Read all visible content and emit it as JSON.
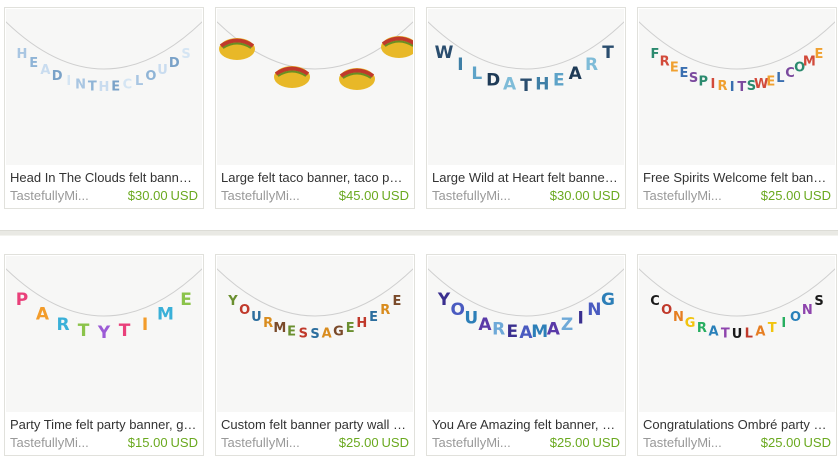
{
  "listings": [
    {
      "title": "Head In The Clouds felt banner, party garland, wall decor",
      "shop": "TastefullyMi...",
      "price": "$30.00",
      "currency": "USD",
      "image_text": "HEAD IN THE CLOUDS",
      "palette": [
        "#a9c6e2",
        "#8fb4d6",
        "#c9dcef",
        "#7aa2c8",
        "#d5e5f3"
      ]
    },
    {
      "title": "Large felt taco banner, taco party garland",
      "shop": "TastefullyMi...",
      "price": "$45.00",
      "currency": "USD",
      "image_text": "",
      "palette": [
        "#e8b828",
        "#c0392b",
        "#6b8e23",
        "#d8a01a"
      ]
    },
    {
      "title": "Large Wild at Heart felt banner, party garland",
      "shop": "TastefullyMi...",
      "price": "$30.00",
      "currency": "USD",
      "image_text": "WILD AT HEART",
      "palette": [
        "#2a4d6e",
        "#3f7fa6",
        "#5ea3c8",
        "#1f3b57",
        "#7fbcd8"
      ]
    },
    {
      "title": "Free Spirits Welcome felt banner, party garland",
      "shop": "TastefullyMi...",
      "price": "$25.00",
      "currency": "USD",
      "image_text": "FREE SPIRITS WELCOME",
      "palette": [
        "#2b8a6e",
        "#d24a3a",
        "#f0a030",
        "#3a6fb0",
        "#7b4a9e"
      ]
    },
    {
      "title": "Party Time felt party banner, garland",
      "shop": "TastefullyMi...",
      "price": "$15.00",
      "currency": "USD",
      "image_text": "PARTY TIME",
      "palette": [
        "#e9407a",
        "#f39c2a",
        "#3ab0d8",
        "#8bc34a",
        "#9c5bd6"
      ]
    },
    {
      "title": "Custom felt banner party wall decor",
      "shop": "TastefullyMi...",
      "price": "$25.00",
      "currency": "USD",
      "image_text": "YOUR MESSAGE HERE",
      "palette": [
        "#6a8f2f",
        "#c0392b",
        "#2c6e9e",
        "#d98c1e",
        "#7a4a2a"
      ]
    },
    {
      "title": "You Are Amazing felt banner, party garland",
      "shop": "TastefullyMi...",
      "price": "$25.00",
      "currency": "USD",
      "image_text": "YOU ARE AMAZING",
      "palette": [
        "#3a2f8f",
        "#4a5bc0",
        "#2d7fb8",
        "#5a3aa8",
        "#6ea9d8"
      ]
    },
    {
      "title": "Congratulations Ombré party banner, garland",
      "shop": "TastefullyMi...",
      "price": "$25.00",
      "currency": "USD",
      "image_text": "CONGRATULATIONS",
      "palette": [
        "#1a1a1a",
        "#c0392b",
        "#e67e22",
        "#f1c40f",
        "#27ae60",
        "#2980b9",
        "#8e44ad"
      ]
    }
  ],
  "colors": {
    "price": "#6aa91f",
    "shop": "#999999",
    "title": "#333333",
    "border": "#e1e1dc"
  }
}
